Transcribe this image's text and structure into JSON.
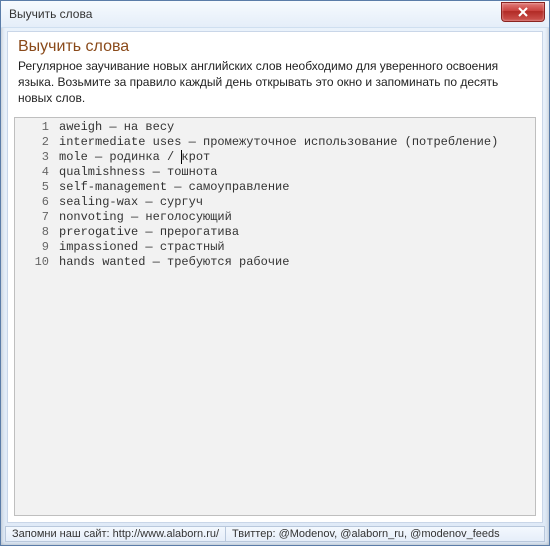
{
  "window": {
    "title": "Выучить слова"
  },
  "header": {
    "title": "Выучить слова",
    "description": "Регулярное заучивание новых английских слов необходимо для уверенного освоения языка. Возьмите за правило каждый день открывать это окно и запоминать по десять новых слов."
  },
  "icons": {
    "close": "close-icon"
  },
  "editor": {
    "lines": [
      "aweigh — на весу",
      "intermediate uses — промежуточное использование (потребление)",
      "mole — родинка / крот",
      "qualmishness — тошнота",
      "self-management — самоуправление",
      "sealing-wax — сургуч",
      "nonvoting — неголосующий",
      "prerogative — прерогатива",
      "impassioned — страстный",
      "hands wanted — требуются рабочие"
    ],
    "caret": {
      "line": 3,
      "col": 18
    }
  },
  "statusbar": {
    "left": "Запомни наш сайт: http://www.alaborn.ru/",
    "right": "Твиттер: @Modenov, @alaborn_ru, @modenov_feeds"
  }
}
